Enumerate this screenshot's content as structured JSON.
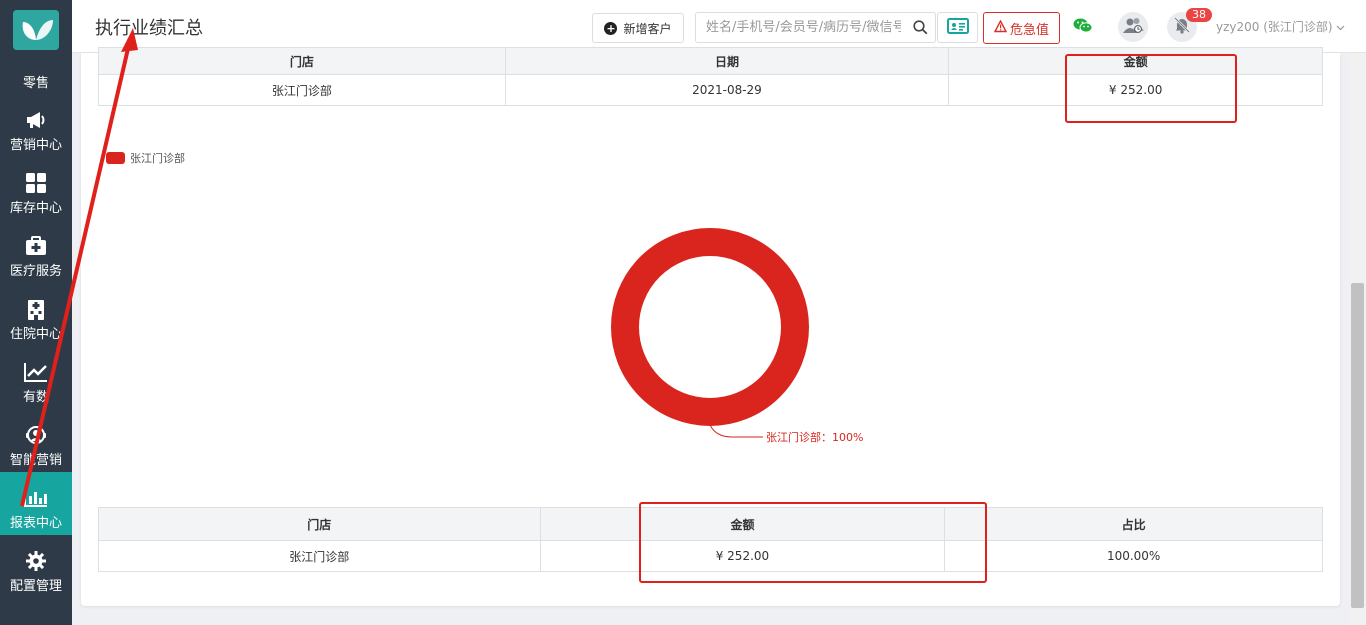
{
  "sidebar": {
    "items": [
      {
        "label": "零售",
        "icon": "logo-butterfly-icon"
      },
      {
        "label": "营销中心",
        "icon": "megaphone-icon"
      },
      {
        "label": "库存中心",
        "icon": "grid-icon"
      },
      {
        "label": "医疗服务",
        "icon": "medical-kit-icon"
      },
      {
        "label": "住院中心",
        "icon": "hospital-icon"
      },
      {
        "label": "有数",
        "icon": "trend-chart-icon"
      },
      {
        "label": "智能营销",
        "icon": "support-agent-icon"
      },
      {
        "label": "报表中心",
        "icon": "bar-chart-icon",
        "active": true
      },
      {
        "label": "配置管理",
        "icon": "gear-icon"
      }
    ]
  },
  "header": {
    "title": "执行业绩汇总",
    "new_customer": "新增客户",
    "search_placeholder": "姓名/手机号/会员号/病历号/微信号",
    "danger_label": "危急值",
    "notification_count": "38",
    "user": "yzy200 (张江门诊部)"
  },
  "top_table": {
    "headers": [
      "门店",
      "日期",
      "金额"
    ],
    "rows": [
      [
        "张江门诊部",
        "2021-08-29",
        "¥  252.00"
      ]
    ]
  },
  "chart_data": {
    "type": "pie",
    "legend": [
      "张江门诊部"
    ],
    "legend_position": "top-left",
    "slices": [
      {
        "label": "张江门诊部",
        "value": 252.0,
        "percent": 100
      }
    ],
    "slice_label": "张江门诊部：100%",
    "colors": [
      "#d9251d"
    ]
  },
  "bottom_table": {
    "headers": [
      "门店",
      "金额",
      "占比"
    ],
    "rows": [
      [
        "张江门诊部",
        "¥  252.00",
        "100.00%"
      ]
    ]
  },
  "colors": {
    "sidebar": "#2e3a47",
    "active": "#17a5a0",
    "accent_red": "#d9302a"
  }
}
